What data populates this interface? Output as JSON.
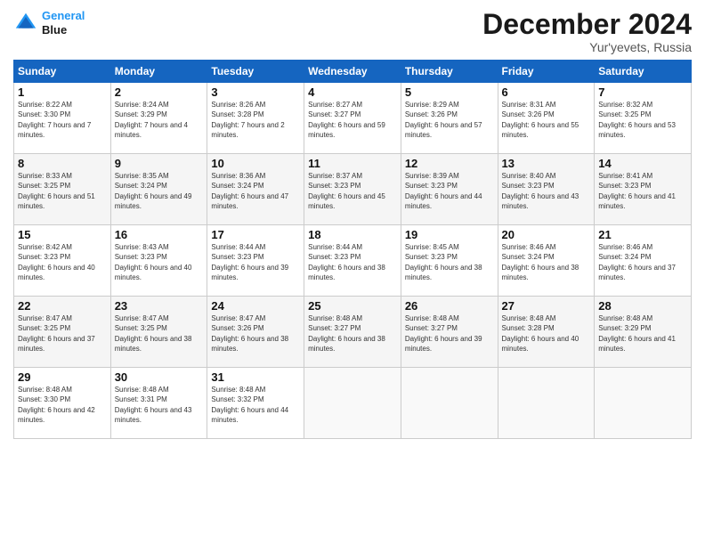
{
  "header": {
    "logo_line1": "General",
    "logo_line2": "Blue",
    "month": "December 2024",
    "location": "Yur'yevets, Russia"
  },
  "days_of_week": [
    "Sunday",
    "Monday",
    "Tuesday",
    "Wednesday",
    "Thursday",
    "Friday",
    "Saturday"
  ],
  "weeks": [
    [
      {
        "day": "1",
        "sunrise": "8:22 AM",
        "sunset": "3:30 PM",
        "daylight": "7 hours and 7 minutes."
      },
      {
        "day": "2",
        "sunrise": "8:24 AM",
        "sunset": "3:29 PM",
        "daylight": "7 hours and 4 minutes."
      },
      {
        "day": "3",
        "sunrise": "8:26 AM",
        "sunset": "3:28 PM",
        "daylight": "7 hours and 2 minutes."
      },
      {
        "day": "4",
        "sunrise": "8:27 AM",
        "sunset": "3:27 PM",
        "daylight": "6 hours and 59 minutes."
      },
      {
        "day": "5",
        "sunrise": "8:29 AM",
        "sunset": "3:26 PM",
        "daylight": "6 hours and 57 minutes."
      },
      {
        "day": "6",
        "sunrise": "8:31 AM",
        "sunset": "3:26 PM",
        "daylight": "6 hours and 55 minutes."
      },
      {
        "day": "7",
        "sunrise": "8:32 AM",
        "sunset": "3:25 PM",
        "daylight": "6 hours and 53 minutes."
      }
    ],
    [
      {
        "day": "8",
        "sunrise": "8:33 AM",
        "sunset": "3:25 PM",
        "daylight": "6 hours and 51 minutes."
      },
      {
        "day": "9",
        "sunrise": "8:35 AM",
        "sunset": "3:24 PM",
        "daylight": "6 hours and 49 minutes."
      },
      {
        "day": "10",
        "sunrise": "8:36 AM",
        "sunset": "3:24 PM",
        "daylight": "6 hours and 47 minutes."
      },
      {
        "day": "11",
        "sunrise": "8:37 AM",
        "sunset": "3:23 PM",
        "daylight": "6 hours and 45 minutes."
      },
      {
        "day": "12",
        "sunrise": "8:39 AM",
        "sunset": "3:23 PM",
        "daylight": "6 hours and 44 minutes."
      },
      {
        "day": "13",
        "sunrise": "8:40 AM",
        "sunset": "3:23 PM",
        "daylight": "6 hours and 43 minutes."
      },
      {
        "day": "14",
        "sunrise": "8:41 AM",
        "sunset": "3:23 PM",
        "daylight": "6 hours and 41 minutes."
      }
    ],
    [
      {
        "day": "15",
        "sunrise": "8:42 AM",
        "sunset": "3:23 PM",
        "daylight": "6 hours and 40 minutes."
      },
      {
        "day": "16",
        "sunrise": "8:43 AM",
        "sunset": "3:23 PM",
        "daylight": "6 hours and 40 minutes."
      },
      {
        "day": "17",
        "sunrise": "8:44 AM",
        "sunset": "3:23 PM",
        "daylight": "6 hours and 39 minutes."
      },
      {
        "day": "18",
        "sunrise": "8:44 AM",
        "sunset": "3:23 PM",
        "daylight": "6 hours and 38 minutes."
      },
      {
        "day": "19",
        "sunrise": "8:45 AM",
        "sunset": "3:23 PM",
        "daylight": "6 hours and 38 minutes."
      },
      {
        "day": "20",
        "sunrise": "8:46 AM",
        "sunset": "3:24 PM",
        "daylight": "6 hours and 38 minutes."
      },
      {
        "day": "21",
        "sunrise": "8:46 AM",
        "sunset": "3:24 PM",
        "daylight": "6 hours and 37 minutes."
      }
    ],
    [
      {
        "day": "22",
        "sunrise": "8:47 AM",
        "sunset": "3:25 PM",
        "daylight": "6 hours and 37 minutes."
      },
      {
        "day": "23",
        "sunrise": "8:47 AM",
        "sunset": "3:25 PM",
        "daylight": "6 hours and 38 minutes."
      },
      {
        "day": "24",
        "sunrise": "8:47 AM",
        "sunset": "3:26 PM",
        "daylight": "6 hours and 38 minutes."
      },
      {
        "day": "25",
        "sunrise": "8:48 AM",
        "sunset": "3:27 PM",
        "daylight": "6 hours and 38 minutes."
      },
      {
        "day": "26",
        "sunrise": "8:48 AM",
        "sunset": "3:27 PM",
        "daylight": "6 hours and 39 minutes."
      },
      {
        "day": "27",
        "sunrise": "8:48 AM",
        "sunset": "3:28 PM",
        "daylight": "6 hours and 40 minutes."
      },
      {
        "day": "28",
        "sunrise": "8:48 AM",
        "sunset": "3:29 PM",
        "daylight": "6 hours and 41 minutes."
      }
    ],
    [
      {
        "day": "29",
        "sunrise": "8:48 AM",
        "sunset": "3:30 PM",
        "daylight": "6 hours and 42 minutes."
      },
      {
        "day": "30",
        "sunrise": "8:48 AM",
        "sunset": "3:31 PM",
        "daylight": "6 hours and 43 minutes."
      },
      {
        "day": "31",
        "sunrise": "8:48 AM",
        "sunset": "3:32 PM",
        "daylight": "6 hours and 44 minutes."
      },
      null,
      null,
      null,
      null
    ]
  ]
}
